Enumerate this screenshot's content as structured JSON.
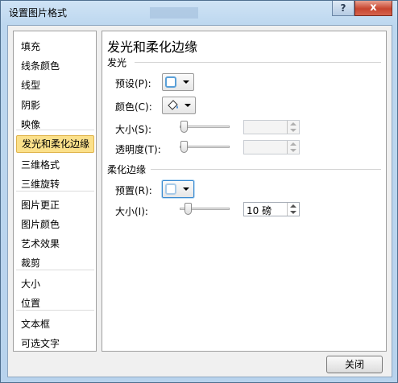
{
  "window": {
    "title": "设置图片格式",
    "help": "?",
    "close": "x"
  },
  "sidebar": {
    "items": [
      "填充",
      "线条颜色",
      "线型",
      "阴影",
      "映像",
      "发光和柔化边缘",
      "三维格式",
      "三维旋转",
      "图片更正",
      "图片颜色",
      "艺术效果",
      "裁剪",
      "大小",
      "位置",
      "文本框",
      "可选文字"
    ],
    "selected": "发光和柔化边缘"
  },
  "content": {
    "heading": "发光和柔化边缘",
    "glow": {
      "section": "发光",
      "preset_label": "预设(P):",
      "color_label": "颜色(C):",
      "size_label": "大小(S):",
      "size_value": "",
      "transparency_label": "透明度(T):",
      "transparency_value": ""
    },
    "soft_edges": {
      "section": "柔化边缘",
      "preset_label": "预置(R):",
      "size_label": "大小(I):",
      "size_value": "10 磅"
    }
  },
  "footer": {
    "close_label": "关闭"
  },
  "colors": {
    "selected_bg": "#fbe08a",
    "accent": "#5aa0d8"
  }
}
